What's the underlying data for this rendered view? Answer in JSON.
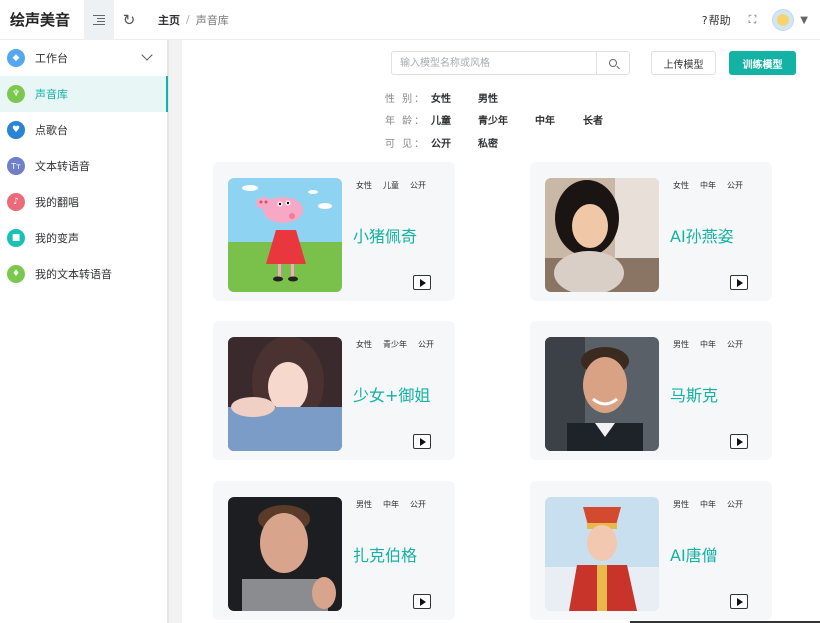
{
  "app": {
    "title": "绘声美音"
  },
  "breadcrumb": {
    "home": "主页",
    "sep": "/",
    "current": "声音库"
  },
  "topbar": {
    "help": "帮助",
    "help_icon": "?"
  },
  "sidebar": {
    "items": [
      {
        "label": "工作台",
        "icon": "diamond-icon",
        "color": "#55a7f0",
        "glyph": "◆"
      },
      {
        "label": "声音库",
        "icon": "trophy-icon",
        "color": "#7cc84e",
        "glyph": "♆"
      },
      {
        "label": "点歌台",
        "icon": "heart-icon",
        "color": "#2a83d6",
        "glyph": "♥"
      },
      {
        "label": "文本转语音",
        "icon": "text-icon",
        "color": "#6f7fc8",
        "glyph": "Tт"
      },
      {
        "label": "我的翻唱",
        "icon": "music-icon",
        "color": "#ec6a7a",
        "glyph": "♪"
      },
      {
        "label": "我的变声",
        "icon": "video-icon",
        "color": "#17c2b4",
        "glyph": "■"
      },
      {
        "label": "我的文本转语音",
        "icon": "mic-icon",
        "color": "#7cc84e",
        "glyph": "♦"
      }
    ]
  },
  "search": {
    "placeholder": "输入模型名称或风格",
    "value": ""
  },
  "buttons": {
    "upload": "上传模型",
    "train": "训练模型"
  },
  "filters": [
    {
      "label": "性 别：",
      "options": [
        "女性",
        "男性"
      ]
    },
    {
      "label": "年 龄：",
      "options": [
        "儿童",
        "青少年",
        "中年",
        "长者"
      ]
    },
    {
      "label": "可 见：",
      "options": [
        "公开",
        "私密"
      ]
    }
  ],
  "cards": [
    {
      "name": "小猪佩奇",
      "tags": [
        "女性",
        "儿童",
        "公开"
      ],
      "image": "cartoon-pig"
    },
    {
      "name": "AI孙燕姿",
      "tags": [
        "女性",
        "中年",
        "公开"
      ],
      "image": "woman-photo"
    },
    {
      "name": "少女+御姐",
      "tags": [
        "女性",
        "青少年",
        "公开"
      ],
      "image": "girl-photo"
    },
    {
      "name": "马斯克",
      "tags": [
        "男性",
        "中年",
        "公开"
      ],
      "image": "man-photo"
    },
    {
      "name": "扎克伯格",
      "tags": [
        "男性",
        "中年",
        "公开"
      ],
      "image": "man-photo-dark"
    },
    {
      "name": "AI唐僧",
      "tags": [
        "男性",
        "中年",
        "公开"
      ],
      "image": "monk-photo"
    }
  ],
  "colors": {
    "accent": "#13b2a4",
    "card_bg": "#f6f7f9"
  }
}
